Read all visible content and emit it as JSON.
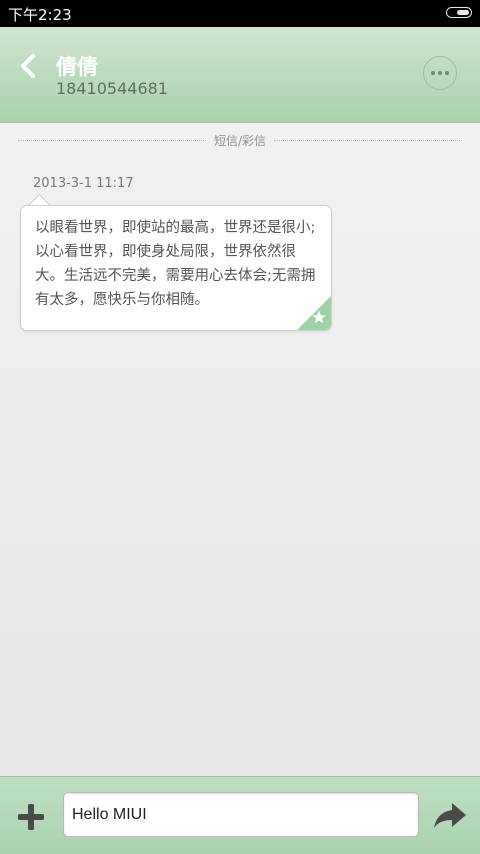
{
  "status_bar": {
    "time": "下午2:23",
    "battery_icon": "battery-icon"
  },
  "header": {
    "contact_name": "倩倩",
    "contact_number": "18410544681",
    "back_icon": "chevron-left-icon",
    "more_icon": "more-dots-icon"
  },
  "conversation": {
    "divider_label": "短信/彩信",
    "messages": [
      {
        "timestamp": "2013-3-1 11:17",
        "text": "以眼看世界，即使站的最高，世界还是很小;以心看世界，即使身处局限，世界依然很大。生活远不完美，需要用心去体会;无需拥有太多，愿快乐与你相随。",
        "starred": true
      }
    ]
  },
  "composer": {
    "input_value": "Hello MIUI",
    "add_icon": "plus-icon",
    "send_icon": "send-arrow-icon"
  },
  "colors": {
    "header_green": "#a9d2ad",
    "star_green": "#9fd1a6",
    "status_bar": "#000000"
  }
}
